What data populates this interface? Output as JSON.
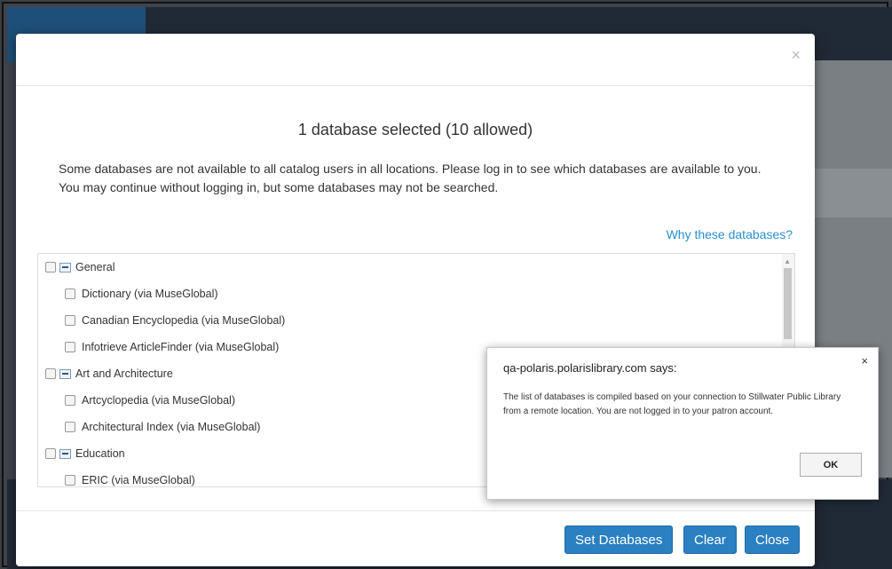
{
  "modal": {
    "close_glyph": "×",
    "title": "1 database selected (10 allowed)",
    "notice": "Some databases are not available to all catalog users in all locations. Please log in to see which databases are available to you. You may continue without logging in, but some databases may not be searched.",
    "why_link": "Why these databases?",
    "tree": [
      {
        "label": "General",
        "group": true
      },
      {
        "label": "Dictionary (via MuseGlobal)",
        "group": false
      },
      {
        "label": "Canadian Encyclopedia (via MuseGlobal)",
        "group": false
      },
      {
        "label": "Infotrieve ArticleFinder (via MuseGlobal)",
        "group": false
      },
      {
        "label": "Art and Architecture",
        "group": true
      },
      {
        "label": "Artcyclopedia (via MuseGlobal)",
        "group": false
      },
      {
        "label": "Architectural Index (via MuseGlobal)",
        "group": false
      },
      {
        "label": "Education",
        "group": true
      },
      {
        "label": "ERIC (via MuseGlobal)",
        "group": false
      }
    ],
    "buttons": {
      "set": "Set Databases",
      "clear": "Clear",
      "close": "Close"
    }
  },
  "dialog": {
    "close_glyph": "×",
    "title": "qa-polaris.polarislibrary.com says:",
    "message": "The list of databases is compiled based on your connection to Stillwater Public Library from a remote location. You are not logged in to your patron account.",
    "ok": "OK"
  },
  "colors": {
    "accent": "#2a80c1",
    "link": "#2b8fd1",
    "backdrop": "#3f444a",
    "topbar": "#202a36"
  }
}
